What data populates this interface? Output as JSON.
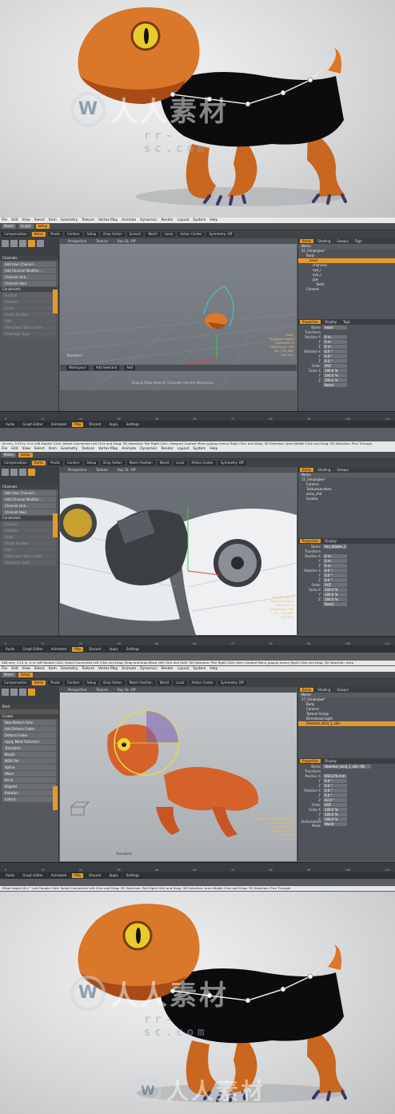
{
  "watermark": {
    "text": "人人素材",
    "url": "rr-sc.com"
  },
  "menu": [
    "File",
    "Edit",
    "View",
    "Select",
    "Item",
    "Geometry",
    "Texture",
    "Vertex Map",
    "Animate",
    "Dynamics",
    "Render",
    "Layout",
    "System",
    "Help"
  ],
  "toolbar": {
    "model": "Model",
    "sculpt": "Sculpt",
    "compensation": "Compensation",
    "items": "Items",
    "pivots": "Pivots",
    "centers": "Centers",
    "setup": "Setup",
    "drop_action": "Drop Action",
    "world": "World",
    "local": "Local",
    "action_center": "Action Center",
    "symmetry": "Symmetry: Off",
    "match_position": "Match Position",
    "scene1": "Scene1"
  },
  "left_panel": {
    "tab": "Setup",
    "channels_title": "Channels",
    "channel_items": [
      "Add User Channel...",
      "Add Channel Modifier...",
      "Channel Link...",
      "Channel Haul"
    ],
    "constraints_title": "Constraints",
    "constraint_items": [
      "Position",
      "Rotation",
      "Scale",
      "Vector Position",
      "Path",
      "Add Linear Tool on Item"
    ],
    "assembly": "Assembly Input",
    "bind": "Bind",
    "create": "Create",
    "deform_items": [
      "New Deform Item",
      "Add Deform Folder",
      "Deform Folder",
      "Apply Mesh Deformer"
    ],
    "deformers": [
      "Transform",
      "Morph",
      "MDD File",
      "Spline",
      "Wave",
      "Bend",
      "Magnet",
      "Rotation",
      "Lattice"
    ]
  },
  "viewport": {
    "tabs": [
      "Perspective",
      "Texture",
      "Ray GL: Off"
    ],
    "hint": "Drag & Drop Items or Channels into the Workspace",
    "workspace": "Workspace",
    "add_selected": "Add Selected",
    "add": "Add",
    "transform": "Transform"
  },
  "panel1": {
    "tree_tabs": [
      "Items",
      "Shading",
      "Groups",
      "Tags"
    ],
    "tree": [
      "Name",
      "02_SimpleJaw*",
      "Body",
      "head",
      "channels",
      "eye_l",
      "eye_r",
      "jaw",
      "Teeth",
      "Camera"
    ],
    "prop_tabs": [
      "Properties",
      "Display",
      "Tags"
    ],
    "name": "head",
    "transform": "Transform",
    "position": [
      "0 m",
      "0 m",
      "0 m"
    ],
    "rotation": [
      "0.0 °",
      "0.0 °",
      "0.0 °"
    ],
    "order": "XYZ",
    "scale": [
      "100.0 %",
      "100.0 %",
      "100.0 %"
    ],
    "reset": "Reset",
    "hud": [
      "Head",
      "Polygons: Quad",
      "Channels: 0",
      "Deformers: ON",
      "GL: 135,380",
      "720 mm"
    ]
  },
  "panel2": {
    "tree": [
      "Name",
      "15_SimpleJaw*",
      "Camera",
      "TextureLocators",
      "arms_shd",
      "Locator"
    ],
    "name": "Fan_blades_2",
    "position": [
      "0 m",
      "0 m",
      "0 m"
    ],
    "rotation": [
      "0.0 °",
      "0.0 °",
      "0.0 °"
    ],
    "order": "XYZ",
    "scale": [
      "100.0 %",
      "100.0 %",
      "100.0 %"
    ],
    "hud": [
      "Fan_blades_2",
      "Polygons: Face",
      "Channels: 2",
      "Deformers: ON",
      "GL: 194,368",
      "200 mm"
    ]
  },
  "panel3": {
    "tree": [
      "Name",
      "17_SimpleJaw*",
      "Body",
      "Camera",
      "Texture Group",
      "Directional Light",
      "Skeleton_bind_1_shin"
    ],
    "name": "Skeleton_bind_1_shin (N)",
    "position": [
      "650.276 mm",
      "0.0 °",
      "0.0 °"
    ],
    "rotation": [
      "0.0 °",
      "0.0 °",
      "43.0 °"
    ],
    "order": "XYZ",
    "scale": [
      "100.0 %",
      "100.0 %",
      "100.0 %"
    ],
    "deformation_mode": "World",
    "hud": [
      "Skeleton_bind_1_shin (N)",
      "Polygons: Face",
      "Channels: 2",
      "Deformers: ON",
      "GL: 5,780",
      "200 mm"
    ]
  },
  "ruler": [
    "0",
    "12",
    "24",
    "36",
    "48",
    "60",
    "72",
    "84",
    "96",
    "108",
    "120"
  ],
  "bottom": {
    "audio": "Audio",
    "graph_editor": "Graph Editor",
    "animated": "Animated",
    "play": "Play",
    "discard": "Discard",
    "apply": "Apply",
    "settings": "Settings"
  },
  "status": [
    "10 mm, 3.29 m, 0 m   Left Double Click: Select Connected  Left Click and Drag: 3D Selection: Poll  Right Click: Viewport Context Menu (popup menu)  Right Click and Drag: 3D Selection: Area  Middle Click and Drag: 3D Selection: Pick Through",
    "360 mm, 1.14 m, 0 m   Left Double Click: Select Connected  Left Click and Drag: Drag and Drop Move  Left Click and Shift: 3D Selection: Pick  Right Click: Item Context Menu (popup menu)  Right Click and Drag: 3D Selection: Area",
    "Offset Angle 49.4 °   Left Double Click: Select Connected  Left Click and Drag: 3D Selection: Poll  Right Click and Drag: 3D Selection: Area  Middle Click and Drag: 3D Selection: Pick Through"
  ],
  "colors": {
    "accent": "#e49a2a",
    "dino_orange": "#d9772b",
    "dino_dark": "#a84b18",
    "eye_yellow": "#f0d530",
    "claw_purple": "#4a3a6a"
  }
}
